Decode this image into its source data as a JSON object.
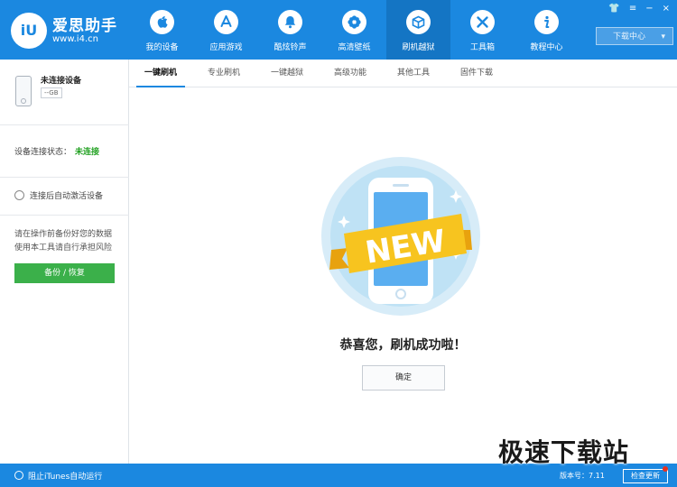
{
  "app": {
    "brand_name": "爱思助手",
    "brand_url": "www.i4.cn",
    "logo_text": "iU"
  },
  "nav": {
    "items": [
      {
        "label": "我的设备",
        "icon": "apple-icon",
        "glyph": ""
      },
      {
        "label": "应用游戏",
        "icon": "app-store-icon",
        "glyph": "A"
      },
      {
        "label": "酷炫铃声",
        "icon": "bell-icon",
        "glyph": "♪"
      },
      {
        "label": "高清壁纸",
        "icon": "flower-icon",
        "glyph": "✿"
      },
      {
        "label": "刷机越狱",
        "icon": "box-icon",
        "glyph": "◈"
      },
      {
        "label": "工具箱",
        "icon": "tools-icon",
        "glyph": "✕"
      },
      {
        "label": "教程中心",
        "icon": "info-icon",
        "glyph": "i"
      }
    ],
    "active_index": 4
  },
  "window_controls": {
    "shirt": "👕",
    "menu": "≡",
    "minimize": "−",
    "close": "×"
  },
  "download_center": {
    "label": "下载中心",
    "caret": "▾"
  },
  "sidebar": {
    "device_name": "未连接设备",
    "device_size": "--GB",
    "status_label": "设备连接状态：",
    "status_value": "未连接",
    "auto_activate_label": "连接后自动激活设备",
    "tip_line1": "请在操作前备份好您的数据",
    "tip_line2": "使用本工具请自行承担风险",
    "backup_button": "备份 / 恢复"
  },
  "tabs": [
    {
      "label": "一键刷机",
      "active": true
    },
    {
      "label": "专业刷机",
      "active": false
    },
    {
      "label": "一键越狱",
      "active": false
    },
    {
      "label": "高级功能",
      "active": false
    },
    {
      "label": "其他工具",
      "active": false
    },
    {
      "label": "固件下载",
      "active": false
    }
  ],
  "main": {
    "badge_text": "NEW",
    "congrats": "恭喜您，刷机成功啦！",
    "ok_button": "确定"
  },
  "statusbar": {
    "itunes_label": "阻止iTunes自动运行",
    "version_label": "版本号：7.11",
    "update_button": "检查更新"
  },
  "watermark": "极速下载站",
  "colors": {
    "primary": "#1b88e0",
    "active_nav": "#1475c4",
    "success_green": "#3bb04a",
    "status_green": "#22a122"
  }
}
